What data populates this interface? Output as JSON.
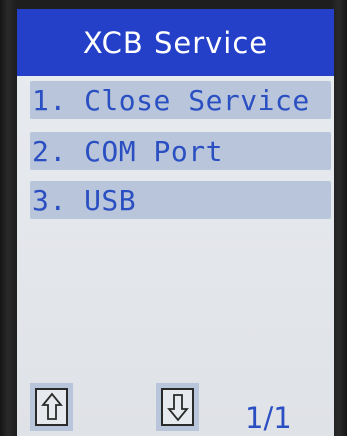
{
  "header": {
    "title": "XCB Service"
  },
  "menu": {
    "items": [
      {
        "label": "1. Close Service"
      },
      {
        "label": "2. COM Port"
      },
      {
        "label": "3. USB"
      }
    ]
  },
  "footer": {
    "up_icon": "arrow-up-icon",
    "down_icon": "arrow-down-icon",
    "page_indicator": "1/1"
  },
  "colors": {
    "title_bar": "#2540c8",
    "item_background": "#b9c5da",
    "item_text": "#2a4fc2",
    "screen_background": "#e6e9ee"
  }
}
